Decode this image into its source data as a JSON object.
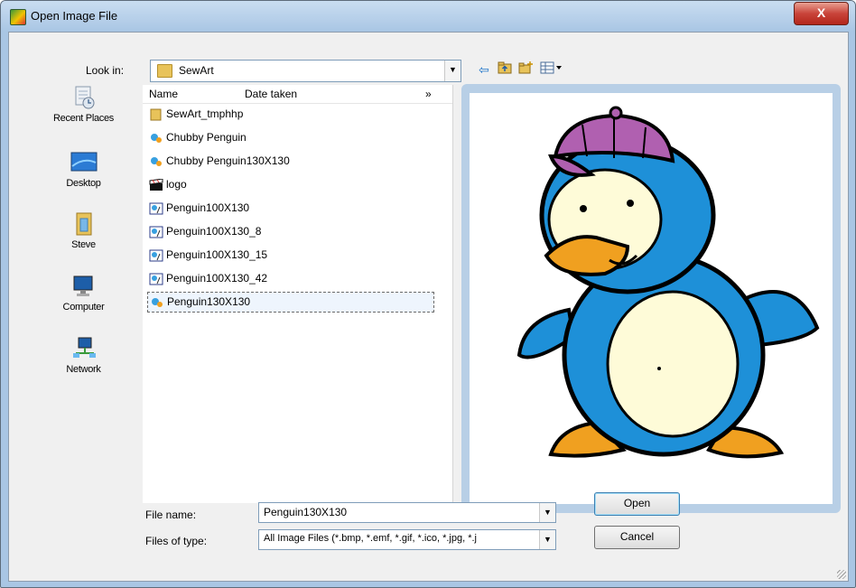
{
  "window": {
    "title": "Open Image File",
    "close_label": "X",
    "icon": "app-image-icon"
  },
  "toolbar": {
    "lookin_label": "Look in:",
    "lookin_value": "SewArt",
    "icons": [
      "back-arrow-icon",
      "up-folder-icon",
      "new-folder-icon",
      "views-menu-icon"
    ]
  },
  "places": [
    {
      "label": "Recent Places",
      "icon": "recent-places-icon"
    },
    {
      "label": "Desktop",
      "icon": "desktop-icon"
    },
    {
      "label": "Steve",
      "icon": "user-folder-icon"
    },
    {
      "label": "Computer",
      "icon": "computer-icon"
    },
    {
      "label": "Network",
      "icon": "network-icon"
    }
  ],
  "filelist": {
    "columns": [
      "Name",
      "Date taken",
      "»"
    ],
    "items": [
      {
        "name": "SewArt_tmphhp",
        "icon": "folder-icon"
      },
      {
        "name": "Chubby Penguin",
        "icon": "image-file-icon"
      },
      {
        "name": "Chubby Penguin130X130",
        "icon": "image-file-icon"
      },
      {
        "name": "logo",
        "icon": "clapper-file-icon"
      },
      {
        "name": "Penguin100X130",
        "icon": "image-file-icon"
      },
      {
        "name": "Penguin100X130_8",
        "icon": "image-file-icon"
      },
      {
        "name": "Penguin100X130_15",
        "icon": "image-file-icon"
      },
      {
        "name": "Penguin100X130_42",
        "icon": "image-file-icon"
      },
      {
        "name": "Penguin130X130",
        "icon": "image-file-icon",
        "selected": true
      }
    ]
  },
  "preview": {
    "image": "penguin-preview-image"
  },
  "form": {
    "filename_label": "File name:",
    "filename_value": "Penguin130X130",
    "filetype_label": "Files of type:",
    "filetype_value": "All Image Files (*.bmp, *.emf, *.gif, *.ico, *.jpg, *.j",
    "open_label": "Open",
    "cancel_label": "Cancel"
  }
}
